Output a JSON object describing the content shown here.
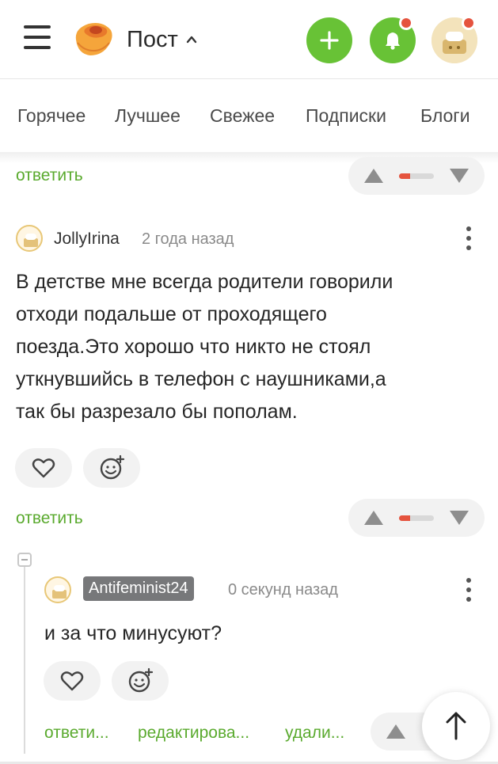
{
  "header": {
    "title": "Пост",
    "icons": {
      "menu": "hamburger-icon",
      "logo": "pikabu-logo",
      "title_toggle": "chevron-up-icon",
      "create": "plus-icon",
      "notifications": "bell-icon",
      "profile": "avatar"
    },
    "colors": {
      "accent_green": "#68c236",
      "notification_red": "#e5533e"
    }
  },
  "tabs": [
    "Горячее",
    "Лучшее",
    "Свежее",
    "Подписки",
    "Блоги"
  ],
  "top_actions": {
    "reply_label": "ответить"
  },
  "comments": [
    {
      "author": "JollyIrina",
      "time": "2 года назад",
      "text_lines": [
        "В детстве мне всегда родители говорили",
        "отходи подальше от проходящего",
        "поезда.Это хорошо что никто не стоял",
        "уткнувшийсь в телефон с наушниками,а",
        "так бы разрезало бы пополам."
      ],
      "reply_label": "ответить"
    },
    {
      "author": "Antifeminist24",
      "time": "0 секунд назад",
      "text": "и за что минусуют?",
      "actions": [
        "ответи...",
        "редактирова...",
        "удали..."
      ]
    }
  ]
}
